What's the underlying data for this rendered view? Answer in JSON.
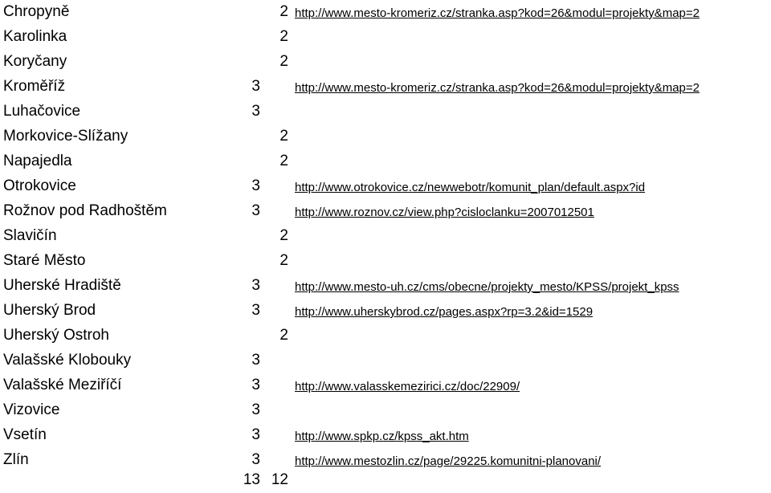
{
  "rows": [
    {
      "name": "Chropyně",
      "v3": "",
      "v2": "2",
      "url": "http://www.mesto-kromeriz.cz/stranka.asp?kod=26&modul=projekty&map=2"
    },
    {
      "name": "Karolinka",
      "v3": "",
      "v2": "2",
      "url": ""
    },
    {
      "name": "Koryčany",
      "v3": "",
      "v2": "2",
      "url": ""
    },
    {
      "name": "Kroměříž",
      "v3": "3",
      "v2": "",
      "url": "http://www.mesto-kromeriz.cz/stranka.asp?kod=26&modul=projekty&map=2"
    },
    {
      "name": "Luhačovice",
      "v3": "3",
      "v2": "",
      "url": ""
    },
    {
      "name": "Morkovice-Slížany",
      "v3": "",
      "v2": "2",
      "url": ""
    },
    {
      "name": "Napajedla",
      "v3": "",
      "v2": "2",
      "url": ""
    },
    {
      "name": "Otrokovice",
      "v3": "3",
      "v2": "",
      "url": "http://www.otrokovice.cz/newwebotr/komunit_plan/default.aspx?id"
    },
    {
      "name": "Rožnov pod Radhoštěm",
      "v3": "3",
      "v2": "",
      "url": "http://www.roznov.cz/view.php?cisloclanku=2007012501"
    },
    {
      "name": "Slavičín",
      "v3": "",
      "v2": "2",
      "url": ""
    },
    {
      "name": "Staré Město",
      "v3": "",
      "v2": "2",
      "url": ""
    },
    {
      "name": "Uherské Hradiště",
      "v3": "3",
      "v2": "",
      "url": "http://www.mesto-uh.cz/cms/obecne/projekty_mesto/KPSS/projekt_kpss"
    },
    {
      "name": "Uherský Brod",
      "v3": "3",
      "v2": "",
      "url": "http://www.uherskybrod.cz/pages.aspx?rp=3.2&id=1529"
    },
    {
      "name": "Uherský Ostroh",
      "v3": "",
      "v2": "2",
      "url": ""
    },
    {
      "name": "Valašské Klobouky",
      "v3": "3",
      "v2": "",
      "url": ""
    },
    {
      "name": "Valašské Meziříčí",
      "v3": "3",
      "v2": "",
      "url": "http://www.valasskemezirici.cz/doc/22909/"
    },
    {
      "name": "Vizovice",
      "v3": "3",
      "v2": "",
      "url": ""
    },
    {
      "name": "Vsetín",
      "v3": "3",
      "v2": "",
      "url": "http://www.spkp.cz/kpss_akt.htm"
    },
    {
      "name": "Zlín",
      "v3": "3",
      "v2": "",
      "url": "http://www.mestozlin.cz/page/29225.komunitni-planovani/"
    }
  ],
  "totals": {
    "v3": "13",
    "v2": "12"
  }
}
